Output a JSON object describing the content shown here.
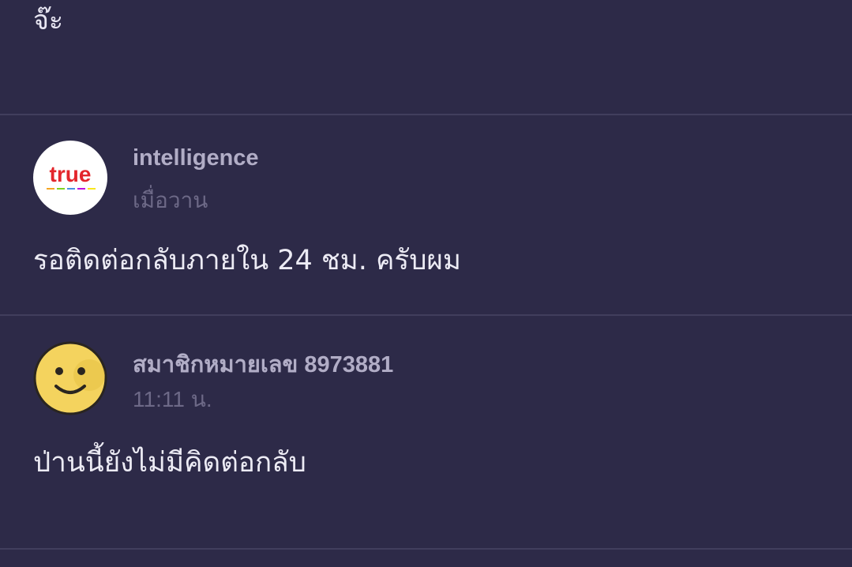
{
  "thread": {
    "previous_comment_tail": "จ๊ะ",
    "comments": [
      {
        "author": "intelligence",
        "avatar": "true-logo",
        "avatar_logo_text": "true",
        "time": "เมื่อวาน",
        "body": "รอติดต่อกลับภายใน 24 ชม. ครับผม"
      },
      {
        "author": "สมาชิกหมายเลข 8973881",
        "avatar": "smiley-icon",
        "time": "11:11 น.",
        "body": "ป่านนี้ยังไม่มีคิดต่อกลับ"
      }
    ]
  },
  "colors": {
    "background": "#2d2a48",
    "divider": "#413e5d",
    "author": "#b1adc6",
    "time": "#6d6987",
    "body": "#ecebf4",
    "true_red": "#e3262c",
    "smiley_yellow": "#f4d35e"
  }
}
